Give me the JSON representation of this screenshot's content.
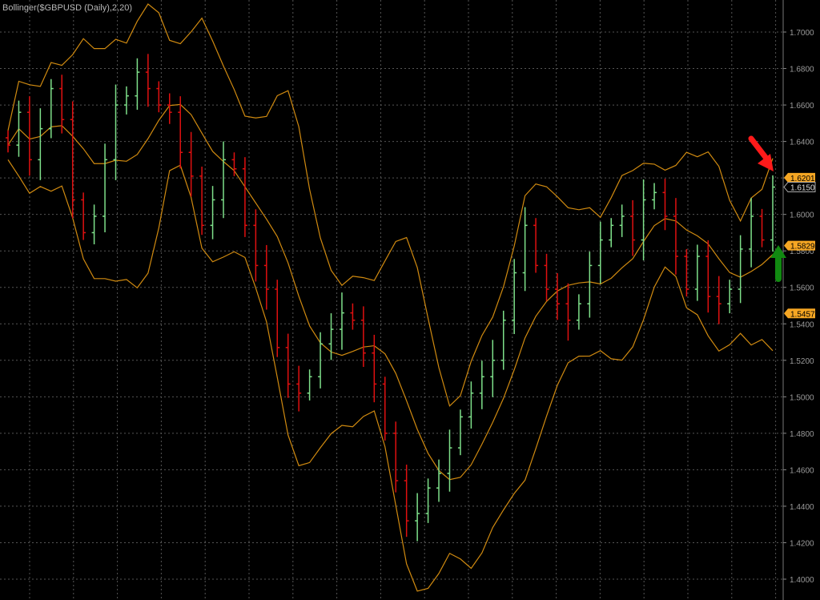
{
  "title": "Bollinger($GBPUSD (Daily),2,20)",
  "colors": {
    "up": "#7ee08a",
    "down": "#e01010",
    "band": "#d08a10",
    "grid": "#555555",
    "tag": "#f5a623"
  },
  "chart_data": {
    "type": "ohlc",
    "title": "Bollinger($GBPUSD (Daily),2,20)",
    "indicator": {
      "name": "Bollinger Bands",
      "std_dev": 2,
      "period": 20
    },
    "ylim": [
      1.4,
      1.7
    ],
    "y_ticks": [
      "1.7000",
      "1.6800",
      "1.6600",
      "1.6400",
      "1.6200",
      "1.6000",
      "1.5800",
      "1.5600",
      "1.5400",
      "1.5200",
      "1.5000",
      "1.4800",
      "1.4600",
      "1.4400",
      "1.4200",
      "1.4000"
    ],
    "closes": [
      1.638,
      1.656,
      1.63,
      1.647,
      1.669,
      1.652,
      1.608,
      1.59,
      1.599,
      1.63,
      1.66,
      1.665,
      1.678,
      1.669,
      1.66,
      1.656,
      1.634,
      1.621,
      1.594,
      1.608,
      1.63,
      1.625,
      1.594,
      1.572,
      1.559,
      1.527,
      1.507,
      1.502,
      1.511,
      1.529,
      1.537,
      1.546,
      1.542,
      1.524,
      1.507,
      1.48,
      1.454,
      1.432,
      1.436,
      1.45,
      1.458,
      1.472,
      1.489,
      1.502,
      1.511,
      1.52,
      1.542,
      1.568,
      1.594,
      1.572,
      1.559,
      1.551,
      1.542,
      1.551,
      1.572,
      1.586,
      1.594,
      1.599,
      1.586,
      1.608,
      1.612,
      1.599,
      1.577,
      1.559,
      1.577,
      1.555,
      1.551,
      1.559,
      1.581,
      1.599,
      1.586,
      1.615
    ],
    "price_tags": [
      {
        "label": "1.6201",
        "value": 1.6201,
        "kind": "upper-band"
      },
      {
        "label": "1.6150",
        "value": 1.615,
        "kind": "last-close"
      },
      {
        "label": "1.5829",
        "value": 1.5829,
        "kind": "middle-band"
      },
      {
        "label": "1.5457",
        "value": 1.5457,
        "kind": "lower-band"
      }
    ],
    "annotations": [
      {
        "type": "arrow",
        "color": "red",
        "points_to": "upper-band touch at last bar"
      },
      {
        "type": "arrow",
        "color": "green",
        "points_to": "middle band"
      }
    ]
  }
}
